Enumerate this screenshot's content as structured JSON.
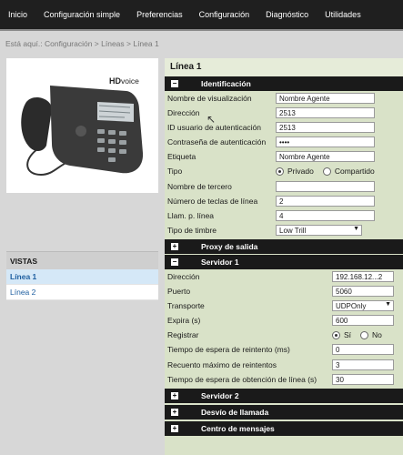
{
  "nav": [
    "Inicio",
    "Configuración simple",
    "Preferencias",
    "Configuración",
    "Diagnóstico",
    "Utilidades"
  ],
  "breadcrumb": "Está aquí.: Configuración > Líneas > Línea 1",
  "product": {
    "brand": "HD",
    "brand_suffix": "voice"
  },
  "views": {
    "title": "VISTAS",
    "items": [
      "Línea 1",
      "Línea 2"
    ]
  },
  "page_title": "Línea 1",
  "sections": {
    "identificacion": "Identificación",
    "proxy": "Proxy de salida",
    "servidor1": "Servidor 1",
    "servidor2": "Servidor 2",
    "desvio": "Desvío de llamada",
    "mensajes": "Centro de mensajes"
  },
  "identificacion": {
    "nombre_label": "Nombre de visualización",
    "nombre_value": "Nombre Agente",
    "direccion_label": "Dirección",
    "direccion_value": "2513",
    "id_label": "ID usuario de autenticación",
    "id_value": "2513",
    "pass_label": "Contraseña de autenticación",
    "pass_value": "••••",
    "etiqueta_label": "Etiqueta",
    "etiqueta_value": "Nombre Agente",
    "tipo_label": "Tipo",
    "tipo_opt1": "Privado",
    "tipo_opt2": "Compartido",
    "tercero_label": "Nombre de tercero",
    "tercero_value": "",
    "teclas_label": "Número de teclas de línea",
    "teclas_value": "2",
    "llam_label": "Llam. p. línea",
    "llam_value": "4",
    "timbre_label": "Tipo de timbre",
    "timbre_value": "Low Trill"
  },
  "servidor1": {
    "direccion_label": "Dirección",
    "direccion_value": "192.168.12...2",
    "puerto_label": "Puerto",
    "puerto_value": "5060",
    "transporte_label": "Transporte",
    "transporte_value": "UDPOnly",
    "expira_label": "Expira (s)",
    "expira_value": "600",
    "registrar_label": "Registrar",
    "registrar_opt1": "Sí",
    "registrar_opt2": "No",
    "reintento_label": "Tiempo de espera de reintento (ms)",
    "reintento_value": "0",
    "recuento_label": "Recuento máximo de reintentos",
    "recuento_value": "3",
    "obtencion_label": "Tiempo de espera de obtención de línea (s)",
    "obtencion_value": "30"
  }
}
